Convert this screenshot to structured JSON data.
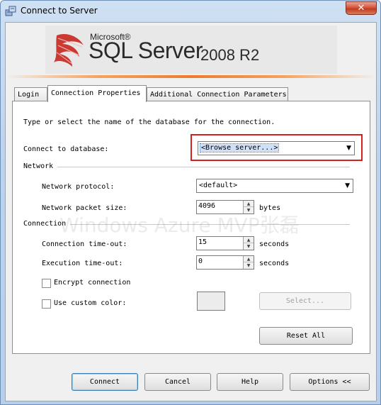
{
  "window": {
    "title": "Connect to Server",
    "close_glyph": "✕"
  },
  "banner": {
    "microsoft": "Microsoft®",
    "product": "SQL Server",
    "version": "2008 R2"
  },
  "tabs": [
    {
      "label": "Login",
      "active": false
    },
    {
      "label": "Connection Properties",
      "active": true
    },
    {
      "label": "Additional Connection Parameters",
      "active": false
    }
  ],
  "panel": {
    "intro": "Type or select the name of the database for the connection.",
    "database": {
      "label": "Connect to database:",
      "value": "<Browse server...>"
    },
    "network": {
      "header": "Network",
      "protocol_label": "Network protocol:",
      "protocol_value": "<default>",
      "packet_label": "Network packet size:",
      "packet_value": "4096",
      "packet_unit": "bytes"
    },
    "connection": {
      "header": "Connection",
      "timeout_label": "Connection time-out:",
      "timeout_value": "15",
      "timeout_unit": "seconds",
      "exec_label": "Execution time-out:",
      "exec_value": "0",
      "exec_unit": "seconds",
      "encrypt_label": "Encrypt connection",
      "encrypt_checked": false,
      "custom_color_label": "Use custom color:",
      "custom_color_checked": false,
      "select_label": "Select...",
      "reset_label": "Reset All"
    }
  },
  "watermark": "Windows Azure MVP张磊",
  "buttons": {
    "connect": "Connect",
    "cancel": "Cancel",
    "help": "Help",
    "options": "Options <<"
  },
  "colors": {
    "highlight": "#d42020",
    "accent_line": "#ee7b2b"
  }
}
